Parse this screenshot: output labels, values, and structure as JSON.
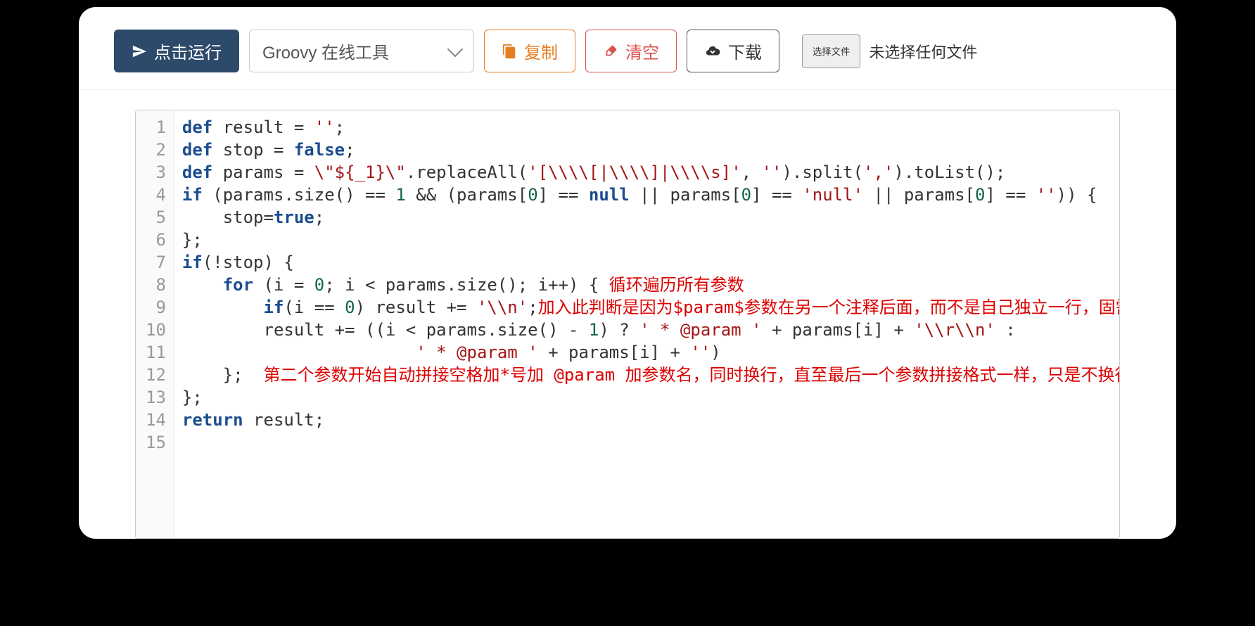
{
  "toolbar": {
    "run_label": "点击运行",
    "select_label": "Groovy 在线工具",
    "copy_label": "复制",
    "clear_label": "清空",
    "download_label": "下载",
    "file_button": "选择文件",
    "file_status": "未选择任何文件"
  },
  "code": {
    "lines": [
      "def result = '';",
      "def stop = false;",
      "def params = \\\"${_1}\\\".replaceAll('[\\\\\\\\[|\\\\\\\\]|\\\\\\\\s]', '').split(',').toList();",
      "if (params.size() == 1 && (params[0] == null || params[0] == 'null' || params[0] == '')) {",
      "    stop=true;",
      "};",
      "if(!stop) {",
      "    for (i = 0; i < params.size(); i++) { 循环遍历所有参数",
      "        if(i == 0) result += '\\\\n';加入此判断是因为$param$参数在另一个注释后面，而不是自己独立一行，固需换行",
      "        result += ((i < params.size() - 1) ? ' * @param ' + params[i] + '\\\\r\\\\n' :",
      "                       ' * @param ' + params[i] + '')",
      "    };  第二个参数开始自动拼接空格加*号加 @param 加参数名，同时换行，直至最后一个参数拼接格式一样，只是不换行而已",
      "};",
      "return result;",
      ""
    ],
    "comments": {
      "line8": "循环遍历所有参数",
      "line9": "加入此判断是因为$param$参数在另一个注释后面，而不是自己独立一行，固需换行",
      "line12": "第二个参数开始自动拼接空格加*号加 @param 加参数名，同时换行，直至最后一个参数拼接格式一样，只是不换行而已"
    },
    "line_count": 15
  }
}
